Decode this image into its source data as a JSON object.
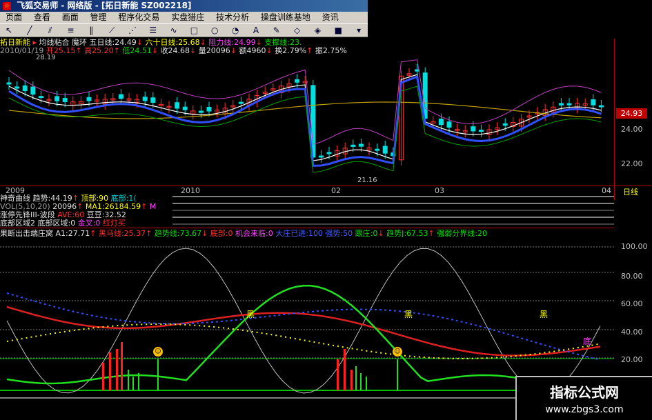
{
  "window": {
    "title": "飞狐交易师 - 网络版 - [拓日新能 SZ002218]"
  },
  "menu": [
    "页面",
    "查看",
    "画面",
    "管理",
    "程序化交易",
    "实盘猎庄",
    "技术分析",
    "操盘训练基地",
    "资讯"
  ],
  "toolbar_icons": [
    "pointer-icon",
    "line-icon",
    "parallel-icon",
    "channel-icon",
    "bars-icon",
    "fan-icon",
    "gann-icon",
    "fib-icon",
    "wave-icon",
    "rectangle-icon",
    "ellipse-icon",
    "cycle-icon",
    "text-icon",
    "paint-icon",
    "eraser-icon",
    "palette-icon",
    "save-icon",
    "more-icon"
  ],
  "main_chart": {
    "stock_name": "拓日新能",
    "indicator_label": "均线粘合",
    "indicator_sub": "魔环",
    "ma5": "五日线:24.49",
    "ma60": "六十日线:25.68",
    "resistance": "阻力线:24.99",
    "support": "支撑线:23.",
    "date": "2010/01/19",
    "open": "开25.15",
    "high": "高25.20",
    "low": "低24.51",
    "close": "收24.68",
    "volume": "量20096",
    "amount": "额4960",
    "turnover": "换2.79%",
    "amplitude": "振2.75%",
    "price_tag": "24.93",
    "high_mark": "28.19",
    "low_mark": "21.16",
    "y_ticks": [
      "24.00",
      "22.00"
    ],
    "x_ticks": [
      "2009",
      "2010",
      "02",
      "03",
      "04"
    ],
    "period": "日线"
  },
  "sub_panel": {
    "line1_name": "神奇曲线",
    "line1_trend": "趋势:44.19",
    "line1_top": "顶部:90",
    "line1_bottom": "底部:1(",
    "line2_vol": "VOL(5,10,20)",
    "line2_v": "20096",
    "line2_ma1": "MA1:26184.59",
    "line2_ma2": "M",
    "line3_name": "涨停先锋III-波段",
    "line3_ave": "AVE:60",
    "line3_doudou": "豆豆:32.52",
    "line4_name": "底部区域2",
    "line4_area": "底部区域:0",
    "line4_cross": "金叉:0",
    "line4_red": "红灯买"
  },
  "bottom_panel": {
    "name": "果断出击端庄窝",
    "a1": "A1:27.71",
    "heima": "黑马线:25.37",
    "qushi": "趋势线:73.67",
    "dibu": "底部:0",
    "jihui": "机会来临:0",
    "dazhuang": "大庄已进:100",
    "qiangshi": "强势:50",
    "genzhuang": "跟庄:0",
    "qushi_j": "趋势J:67.53",
    "qiangruo": "强弱分界线:20",
    "y_ticks": [
      "100.00",
      "80.00",
      "60.00",
      "40.00",
      "20.00"
    ],
    "marks": [
      "黑",
      "黑",
      "黑",
      "底"
    ]
  },
  "watermark": {
    "line1": "指标公式网",
    "line2": "www.zbgs3.com"
  }
}
